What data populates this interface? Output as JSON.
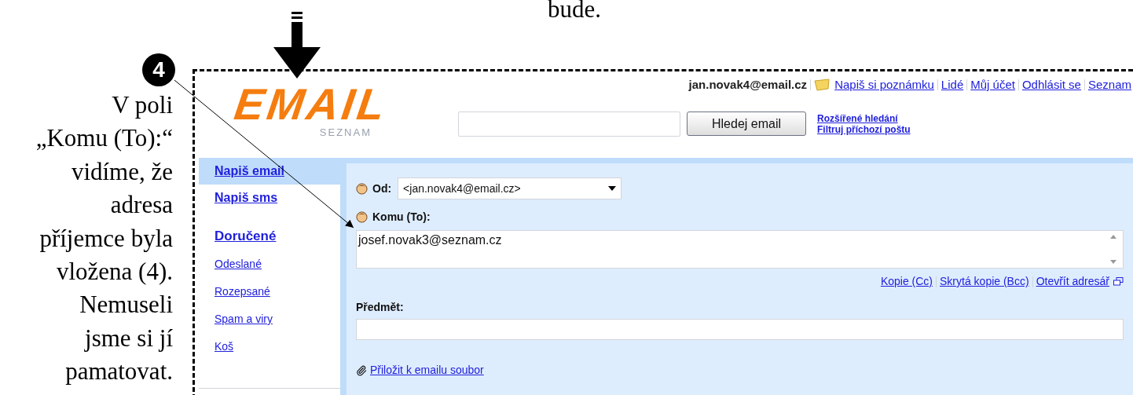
{
  "document": {
    "text_above": "bude.",
    "callout": "4",
    "caption_lines": [
      "V poli",
      "„Komu (To):“",
      "vidíme, že",
      "adresa",
      "příjemce byla",
      "vložena (4).",
      "Nemuseli",
      "jsme si jí",
      "pamatovat."
    ]
  },
  "header": {
    "logo": {
      "word": "EMAIL",
      "sub": "SEZNAM"
    },
    "user": "jan.novak4@email.cz",
    "links": [
      "Napiš si poznámku",
      "Lidé",
      "Můj účet",
      "Odhlásit se",
      "Seznam"
    ],
    "search": {
      "button": "Hledej email"
    },
    "search_links": [
      "Rozšířené hledání",
      "Filtruj příchozí poštu"
    ]
  },
  "sidebar": {
    "items": [
      {
        "label": "Napiš email",
        "kind": "compose",
        "selected": true
      },
      {
        "label": "Napiš sms",
        "kind": "compose",
        "selected": false
      },
      {
        "label": "Doručené",
        "kind": "inbox",
        "selected": false
      },
      {
        "label": "Odeslané",
        "kind": "folder",
        "selected": false
      },
      {
        "label": "Rozepsané",
        "kind": "folder",
        "selected": false
      },
      {
        "label": "Spam a viry",
        "kind": "folder",
        "selected": false
      },
      {
        "label": "Koš",
        "kind": "folder",
        "selected": false
      }
    ]
  },
  "compose": {
    "from": {
      "label": "Od:",
      "value": "<jan.novak4@email.cz>"
    },
    "to": {
      "label": "Komu (To):",
      "value": "josef.novak3@seznam.cz"
    },
    "to_links": [
      "Kopie (Cc)",
      "Skrytá kopie (Bcc)",
      "Otevřít adresář"
    ],
    "subject": {
      "label": "Předmět:"
    },
    "attach": "Přiložit k emailu soubor"
  }
}
